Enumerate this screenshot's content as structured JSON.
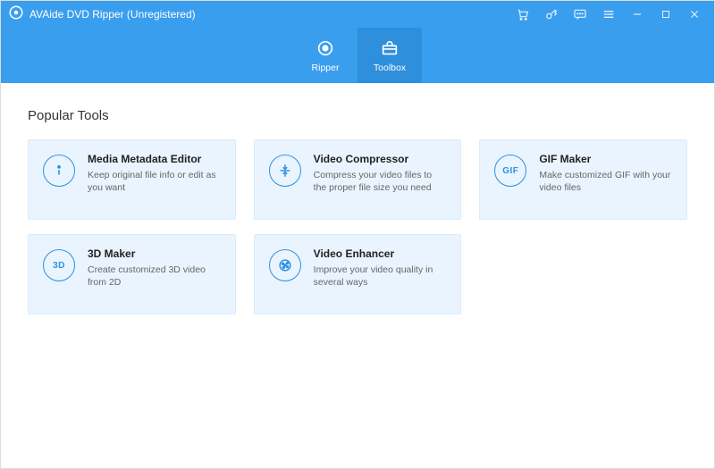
{
  "app": {
    "title": "AVAide DVD Ripper (Unregistered)"
  },
  "tabs": {
    "ripper": {
      "label": "Ripper"
    },
    "toolbox": {
      "label": "Toolbox"
    }
  },
  "section": {
    "title": "Popular Tools"
  },
  "tools": {
    "metadata": {
      "title": "Media Metadata Editor",
      "desc": "Keep original file info or edit as you want"
    },
    "compressor": {
      "title": "Video Compressor",
      "desc": "Compress your video files to the proper file size you need"
    },
    "gif": {
      "title": "GIF Maker",
      "icon_label": "GIF",
      "desc": "Make customized GIF with your video files"
    },
    "maker3d": {
      "title": "3D Maker",
      "icon_label": "3D",
      "desc": "Create customized 3D video from 2D"
    },
    "enhancer": {
      "title": "Video Enhancer",
      "desc": "Improve your video quality in several ways"
    }
  }
}
